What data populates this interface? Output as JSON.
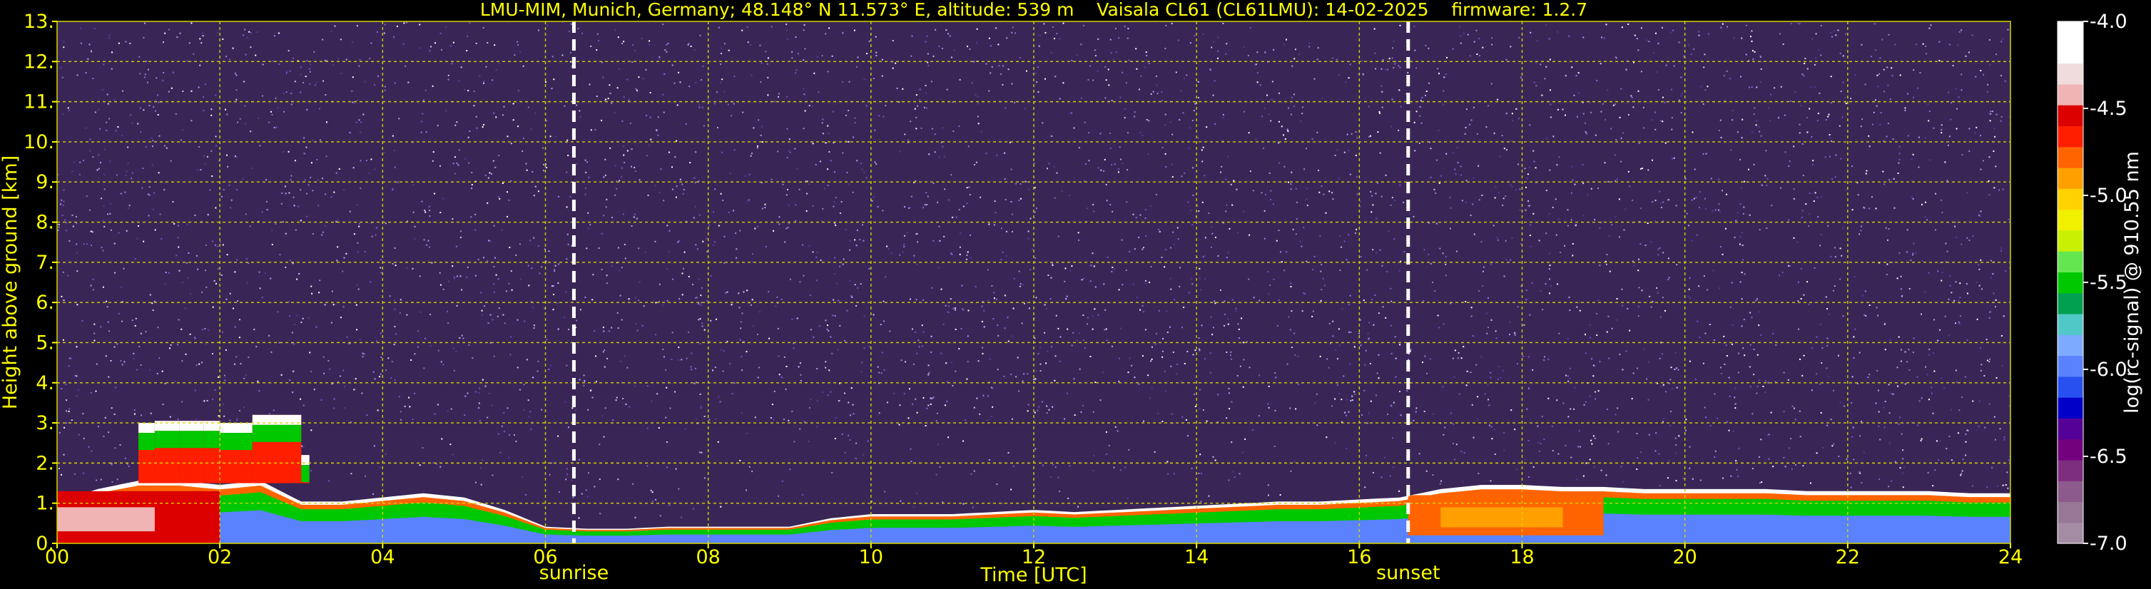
{
  "chart_data": {
    "type": "heatmap",
    "title": "LMU-MIM, Munich, Germany; 48.148° N 11.573° E, altitude: 539 m    Vaisala CL61 (CL61LMU): 14-02-2025    firmware: 1.2.7",
    "xlabel": "Time [UTC]",
    "ylabel": "Height above ground [km]",
    "xlim": [
      0,
      24
    ],
    "ylim": [
      0,
      13
    ],
    "x_ticks": [
      0,
      2,
      4,
      6,
      8,
      10,
      12,
      14,
      16,
      18,
      20,
      22,
      24
    ],
    "x_tick_labels": [
      "00",
      "02",
      "04",
      "06",
      "08",
      "10",
      "12",
      "14",
      "16",
      "18",
      "20",
      "22",
      "24"
    ],
    "y_ticks": [
      0,
      1,
      2,
      3,
      4,
      5,
      6,
      7,
      8,
      9,
      10,
      11,
      12,
      13
    ],
    "y_tick_labels": [
      "0.",
      "1.",
      "2.",
      "3.",
      "4.",
      "5.",
      "6.",
      "7.",
      "8.",
      "9.",
      "10.",
      "11.",
      "12.",
      "13."
    ],
    "grid": true,
    "annotations": [
      {
        "text": "sunrise",
        "x": 6.35
      },
      {
        "text": "sunset",
        "x": 16.6
      }
    ],
    "colorbar": {
      "label": "log(rc-signal) @ 910.55 nm",
      "range": [
        -7.0,
        -4.0
      ],
      "ticks": [
        -7.0,
        -6.5,
        -6.0,
        -5.5,
        -5.0,
        -4.5,
        -4.0
      ],
      "tick_labels": [
        "-7.0",
        "-6.5",
        "-6.0",
        "-5.5",
        "-5.0",
        "-4.5",
        "-4.0"
      ],
      "colors": [
        "#a58ca5",
        "#967896",
        "#8c5a8c",
        "#7d2d7d",
        "#73007d",
        "#550096",
        "#0000c8",
        "#2850f0",
        "#5a82ff",
        "#7daaff",
        "#50c8c8",
        "#00a050",
        "#00c800",
        "#64e650",
        "#c8f000",
        "#f0f000",
        "#ffd200",
        "#ffa000",
        "#ff6400",
        "#ff1e00",
        "#dc0000",
        "#f0b4b4",
        "#f0dcdc",
        "#ffffff",
        "#ffffff"
      ]
    },
    "boundary_layer_top_km": {
      "x": [
        0,
        0.5,
        1,
        1.5,
        2,
        2.5,
        3,
        3.5,
        4,
        4.5,
        5,
        5.5,
        6,
        6.5,
        7,
        7.5,
        8,
        8.5,
        9,
        9.5,
        10,
        10.5,
        11,
        11.5,
        12,
        12.5,
        13,
        13.5,
        14,
        14.5,
        15,
        15.5,
        16,
        16.5,
        17,
        17.5,
        18,
        18.5,
        19,
        19.5,
        20,
        20.5,
        21,
        21.5,
        22,
        22.5,
        23,
        23.5,
        24
      ],
      "y": [
        1.0,
        1.3,
        1.5,
        1.5,
        1.4,
        1.5,
        1.0,
        1.0,
        1.1,
        1.2,
        1.1,
        0.8,
        0.4,
        0.35,
        0.35,
        0.4,
        0.4,
        0.4,
        0.4,
        0.6,
        0.7,
        0.7,
        0.7,
        0.75,
        0.8,
        0.75,
        0.8,
        0.85,
        0.9,
        0.95,
        1.0,
        1.0,
        1.05,
        1.1,
        1.3,
        1.4,
        1.4,
        1.35,
        1.35,
        1.3,
        1.3,
        1.3,
        1.3,
        1.25,
        1.25,
        1.25,
        1.25,
        1.2,
        1.2
      ]
    },
    "residual_layer_top_km": {
      "x": [
        1.0,
        1.2,
        1.5,
        1.8,
        2.0,
        2.4,
        2.7,
        3.0,
        3.1
      ],
      "y": [
        2.8,
        3.0,
        3.05,
        3.05,
        1.6,
        3.0,
        3.2,
        2.2,
        1.5
      ]
    }
  }
}
